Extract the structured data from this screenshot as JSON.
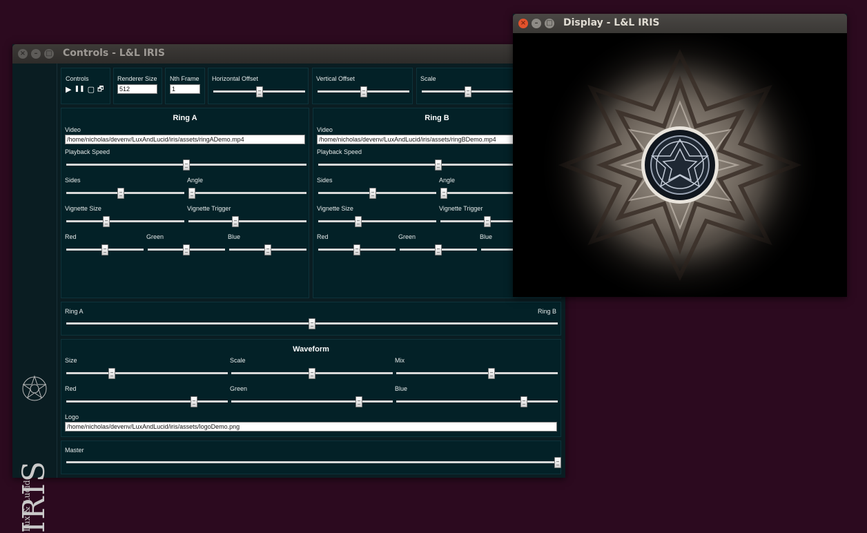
{
  "controls_window": {
    "title": "Controls - L&L IRIS",
    "brand": {
      "name": "IRIS",
      "byline": "Lux & Lucid"
    },
    "top_bar": {
      "controls_label": "Controls",
      "renderer_size_label": "Renderer Size",
      "renderer_size_value": "512",
      "nth_frame_label": "Nth Frame",
      "nth_frame_value": "1",
      "horizontal_offset_label": "Horizontal Offset",
      "horizontal_offset_value": 0.5,
      "vertical_offset_label": "Vertical Offset",
      "vertical_offset_value": 0.5,
      "scale_label": "Scale",
      "scale_value": 0.5
    },
    "ring_a": {
      "title": "Ring A",
      "video_label": "Video",
      "video_path": "/home/nicholas/devenv/LuxAndLucid/iris/assets/ringADemo.mp4",
      "playback_speed_label": "Playback Speed",
      "playback_speed": 0.5,
      "sides_label": "Sides",
      "sides": 0.46,
      "angle_label": "Angle",
      "angle": 0.03,
      "vignette_size_label": "Vignette Size",
      "vignette_size": 0.34,
      "vignette_trigger_label": "Vignette Trigger",
      "vignette_trigger": 0.4,
      "red_label": "Red",
      "red": 0.5,
      "green_label": "Green",
      "green": 0.5,
      "blue_label": "Blue",
      "blue": 0.5
    },
    "ring_b": {
      "title": "Ring B",
      "video_label": "Video",
      "video_path": "/home/nicholas/devenv/LuxAndLucid/iris/assets/ringBDemo.mp4",
      "playback_speed_label": "Playback Speed",
      "playback_speed": 0.5,
      "sides_label": "Sides",
      "sides": 0.46,
      "angle_label": "Angle",
      "angle": 0.03,
      "vignette_size_label": "Vignette Size",
      "vignette_size": 0.34,
      "vignette_trigger_label": "Vignette Trigger",
      "vignette_trigger": 0.4,
      "red_label": "Red",
      "red": 0.5,
      "green_label": "Green",
      "green": 0.5,
      "blue_label": "Blue",
      "blue": 0.5
    },
    "crossfade": {
      "left_label": "Ring A",
      "right_label": "Ring B",
      "value": 0.5
    },
    "waveform": {
      "title": "Waveform",
      "size_label": "Size",
      "size": 0.28,
      "scale_label": "Scale",
      "scale": 0.5,
      "mix_label": "Mix",
      "mix": 0.59,
      "red_label": "Red",
      "red": 0.79,
      "green_label": "Green",
      "green": 0.79,
      "blue_label": "Blue",
      "blue": 0.79,
      "logo_label": "Logo",
      "logo_path": "/home/nicholas/devenv/LuxAndLucid/iris/assets/logoDemo.png"
    },
    "master": {
      "label": "Master",
      "value": 1.0
    }
  },
  "display_window": {
    "title": "Display - L&L IRIS"
  },
  "icons": {
    "close": "×",
    "minimize": "–",
    "maximize": "□",
    "play": "▶",
    "pause": "❚❚",
    "window": "▢",
    "windows": "🗗"
  },
  "colors": {
    "panel": "#032127",
    "background": "#2c0a1f",
    "close_button": "#e2522c"
  }
}
